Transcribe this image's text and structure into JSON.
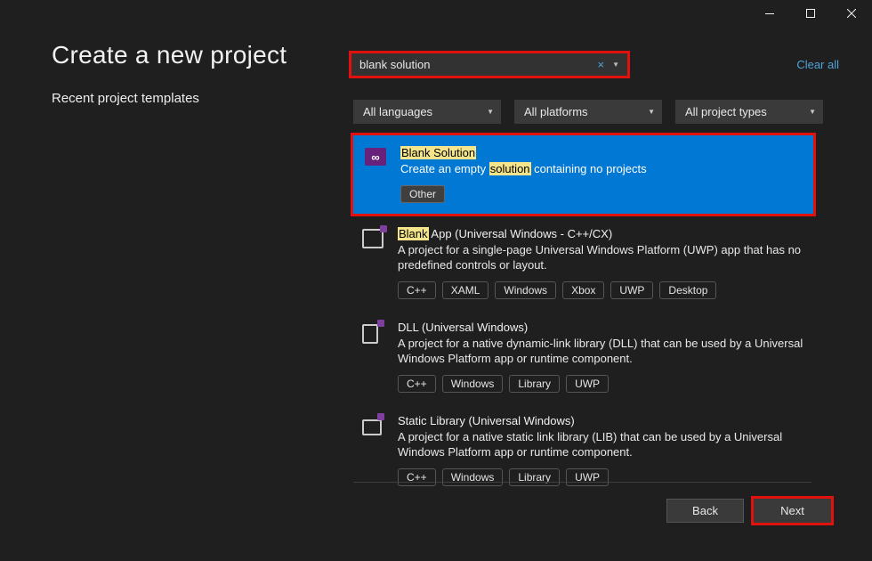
{
  "window": {
    "title": "Create a new project",
    "recent_label": "Recent project templates"
  },
  "search": {
    "query": "blank solution",
    "clear_all": "Clear all"
  },
  "filters": {
    "lang": "All languages",
    "plat": "All platforms",
    "type": "All project types"
  },
  "templates": [
    {
      "id": "blank-solution",
      "title_pre": "",
      "title_hl": "Blank Solution",
      "title_post": "",
      "desc_pre": "Create an empty ",
      "desc_hl": "solution",
      "desc_post": " containing no projects",
      "tags": [
        "Other"
      ],
      "selected": true
    },
    {
      "id": "blank-app",
      "title_pre": "",
      "title_hl": "Blank",
      "title_post": " App (Universal Windows - C++/CX)",
      "desc": "A project for a single-page Universal Windows Platform (UWP) app that has no predefined controls or layout.",
      "tags": [
        "C++",
        "XAML",
        "Windows",
        "Xbox",
        "UWP",
        "Desktop"
      ]
    },
    {
      "id": "dll-uwp",
      "title": "DLL (Universal Windows)",
      "desc": "A project for a native dynamic-link library (DLL) that can be used by a Universal Windows Platform app or runtime component.",
      "tags": [
        "C++",
        "Windows",
        "Library",
        "UWP"
      ]
    },
    {
      "id": "staticlib-uwp",
      "title": "Static Library (Universal Windows)",
      "desc": "A project for a native static link library (LIB) that can be used by a Universal Windows Platform app or runtime component.",
      "tags": [
        "C++",
        "Windows",
        "Library",
        "UWP"
      ]
    }
  ],
  "footer": {
    "back": "Back",
    "next": "Next"
  }
}
